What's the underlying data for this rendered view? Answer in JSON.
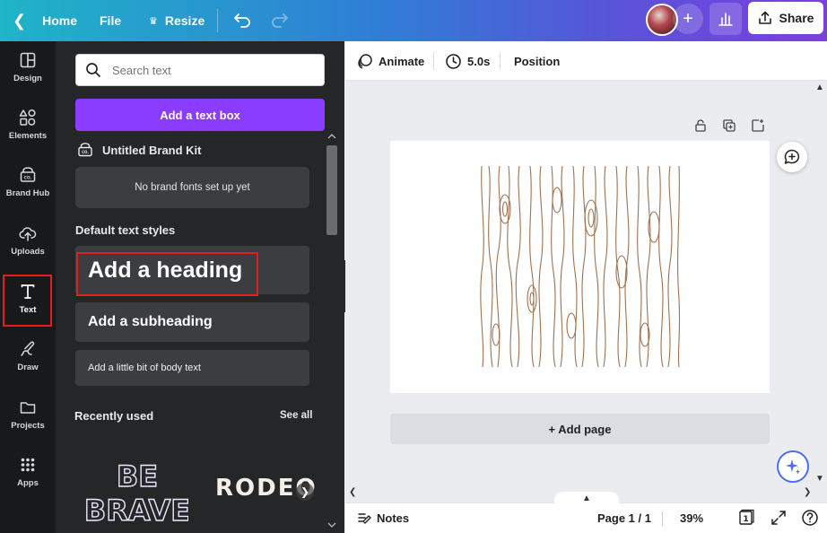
{
  "topbar": {
    "home_label": "Home",
    "file_label": "File",
    "resize_label": "Resize",
    "share_label": "Share",
    "accent_gradient": [
      "#1fb4c6",
      "#7b3fe0"
    ]
  },
  "rail": {
    "items": [
      {
        "label": "Design",
        "icon": "layout-icon"
      },
      {
        "label": "Elements",
        "icon": "shapes-icon"
      },
      {
        "label": "Brand Hub",
        "icon": "brand-icon"
      },
      {
        "label": "Uploads",
        "icon": "cloud-upload-icon"
      },
      {
        "label": "Text",
        "icon": "text-t-icon"
      },
      {
        "label": "Draw",
        "icon": "draw-icon"
      },
      {
        "label": "Projects",
        "icon": "folder-icon"
      },
      {
        "label": "Apps",
        "icon": "grid-icon"
      }
    ],
    "active": "Text"
  },
  "panel": {
    "search_placeholder": "Search text",
    "add_text_box": "Add a text box",
    "brand_kit_title": "Untitled Brand Kit",
    "no_brand_fonts": "No brand fonts set up yet",
    "default_styles_title": "Default text styles",
    "heading": "Add a heading",
    "subheading": "Add a subheading",
    "body": "Add a little bit of body text",
    "recently_used": "Recently used",
    "see_all": "See all",
    "recent_thumbs": [
      "BE BRAVE",
      "RODEO"
    ]
  },
  "editor_toolbar": {
    "animate": "Animate",
    "duration": "5.0s",
    "position": "Position"
  },
  "canvas": {
    "add_page": "+ Add page"
  },
  "bottom_bar": {
    "notes": "Notes",
    "page_indicator": "Page 1 / 1",
    "zoom": "39%",
    "page_count": "1"
  }
}
